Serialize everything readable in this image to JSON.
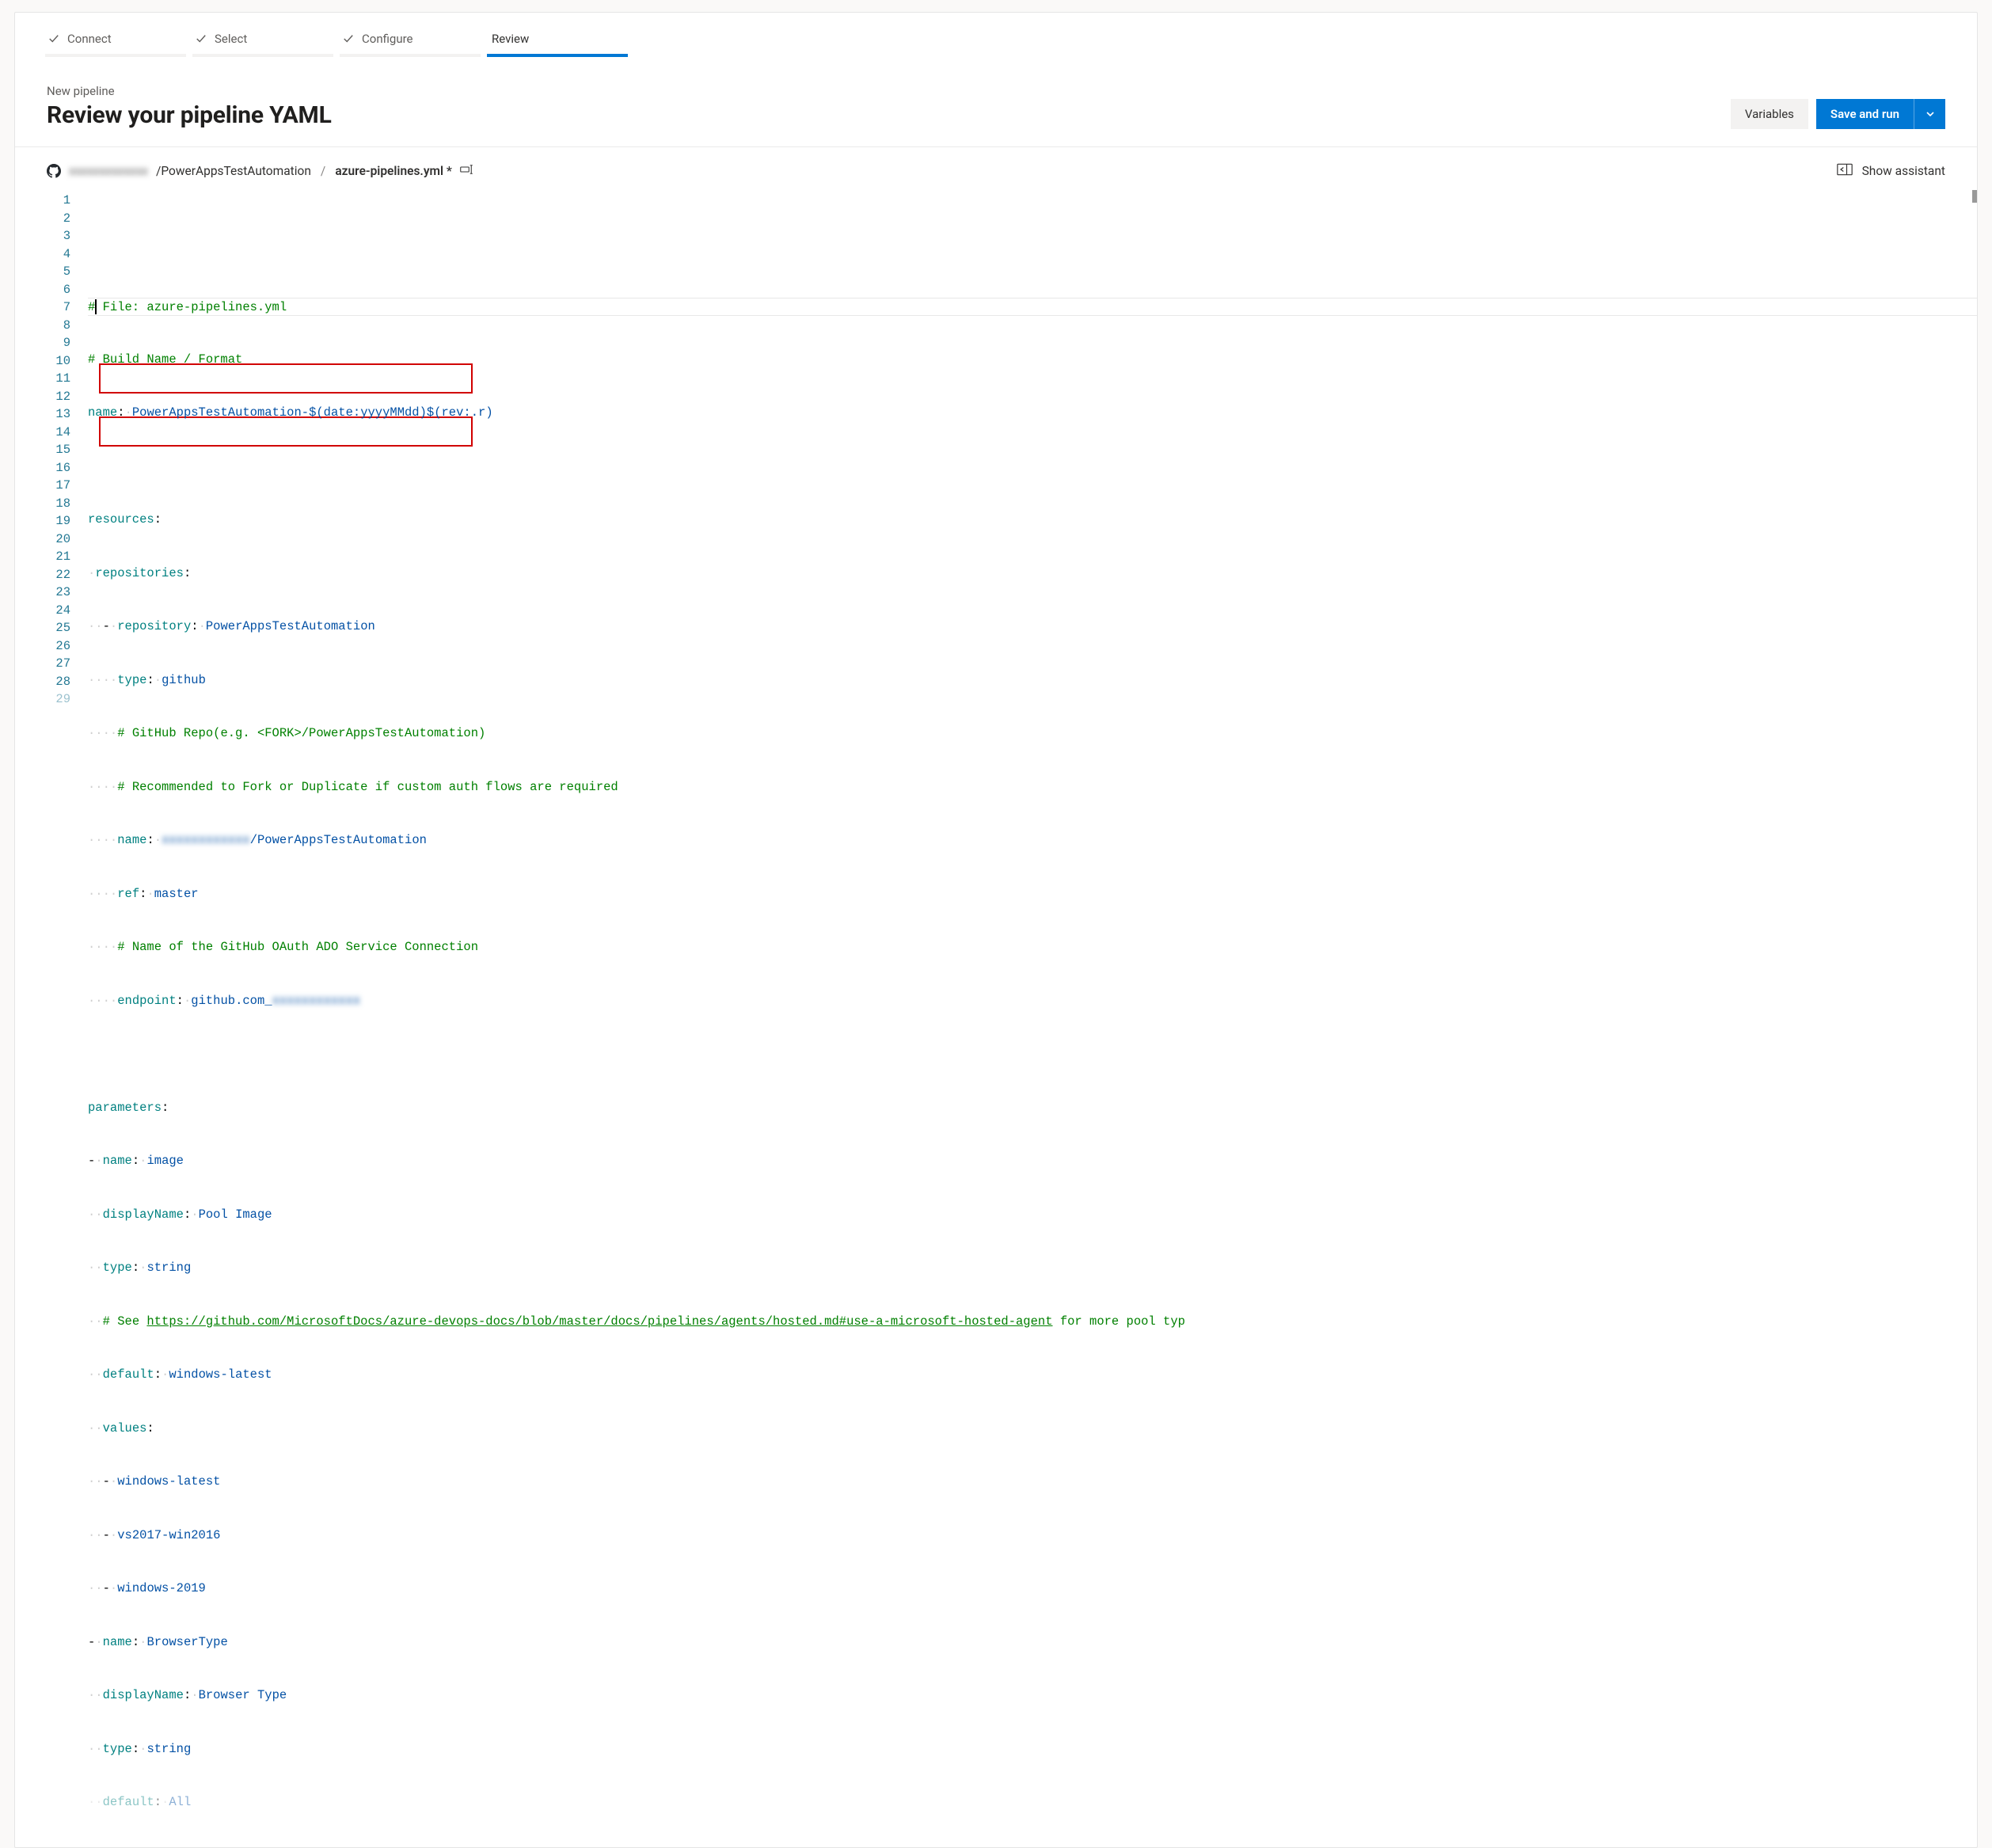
{
  "tabs": {
    "connect": "Connect",
    "select": "Select",
    "configure": "Configure",
    "review": "Review"
  },
  "header": {
    "crumb": "New pipeline",
    "title": "Review your pipeline YAML"
  },
  "actions": {
    "variables": "Variables",
    "save_run": "Save and run"
  },
  "path": {
    "owner_redacted": "xxxxxxxxxxxxx",
    "repo": "/PowerAppsTestAutomation",
    "sep": "/",
    "file": "azure-pipelines.yml *"
  },
  "assistant": "Show assistant",
  "code": {
    "l1": "# File: azure-pipelines.yml",
    "l2": "# Build Name / Format",
    "l3_key": "name",
    "l3_val": "PowerAppsTestAutomation-$(date:yyyyMMdd)$(rev:.r)",
    "l5_key": "resources",
    "l6_key": "repositories",
    "l7_key": "repository",
    "l7_val": "PowerAppsTestAutomation",
    "l8_key": "type",
    "l8_val": "github",
    "l9": "# GitHub Repo(e.g. <FORK>/PowerAppsTestAutomation)",
    "l10": "# Recommended to Fork or Duplicate if custom auth flows are required",
    "l11_key": "name",
    "l11_blur": "xxxxxxxxxxxx",
    "l11_suffix": "/PowerAppsTestAutomation",
    "l12_key": "ref",
    "l12_val": "master",
    "l13": "# Name of the GitHub OAuth ADO Service Connection",
    "l14_key": "endpoint",
    "l14_prefix": "github.com_",
    "l14_blur": "xxxxxxxxxxxx",
    "l16_key": "parameters",
    "l17_key": "name",
    "l17_val": "image",
    "l18_key": "displayName",
    "l18_val": "Pool Image",
    "l19_key": "type",
    "l19_val": "string",
    "l20_pre": "# See ",
    "l20_link": "https://github.com/MicrosoftDocs/azure-devops-docs/blob/master/docs/pipelines/agents/hosted.md#use-a-microsoft-hosted-agent",
    "l20_post": " for more pool typ",
    "l21_key": "default",
    "l21_val": "windows-latest",
    "l22_key": "values",
    "l23_val": "windows-latest",
    "l24_val": "vs2017-win2016",
    "l25_val": "windows-2019",
    "l26_key": "name",
    "l26_val": "BrowserType",
    "l27_key": "displayName",
    "l27_val": "Browser Type",
    "l28_key": "type",
    "l28_val": "string",
    "l29_key": "default",
    "l29_val": "All"
  },
  "dots": {
    "i1": "·",
    "i2": "··",
    "i3": "···",
    "i4": "····",
    "i6": "······"
  }
}
